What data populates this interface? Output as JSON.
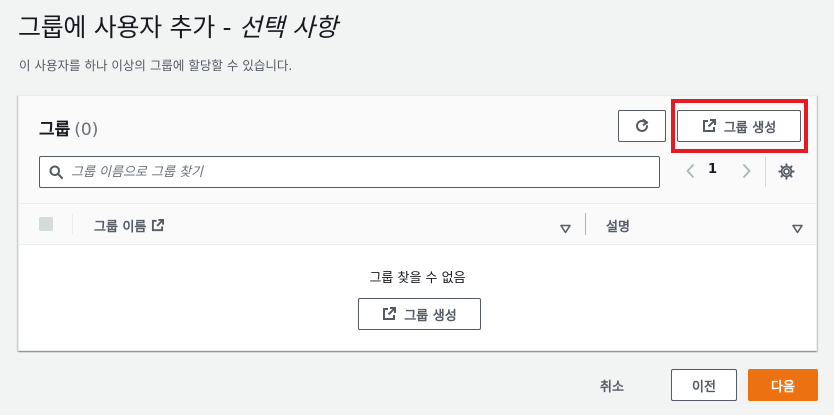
{
  "page": {
    "title_main": "그룹에 사용자 추가 - ",
    "title_optional": "선택 사항",
    "description": "이 사용자를 하나 이상의 그룹에 할당할 수 있습니다."
  },
  "groups_panel": {
    "title": "그룹",
    "count": "(0)",
    "refresh_icon": "refresh-icon",
    "create_button_label": "그룹 생성",
    "create_button_icon": "external-link-icon",
    "highlight_color": "#e31b23",
    "search": {
      "placeholder": "그룹 이름으로 그룹 찾기",
      "value": ""
    },
    "pagination": {
      "current_page": "1"
    },
    "table": {
      "columns": [
        {
          "label": "그룹 이름"
        },
        {
          "label": "설명"
        }
      ],
      "empty_message": "그룹 찾을 수 없음",
      "empty_create_label": "그룹 생성"
    }
  },
  "footer": {
    "cancel_label": "취소",
    "previous_label": "이전",
    "next_label": "다음",
    "primary_color": "#ec7211"
  }
}
